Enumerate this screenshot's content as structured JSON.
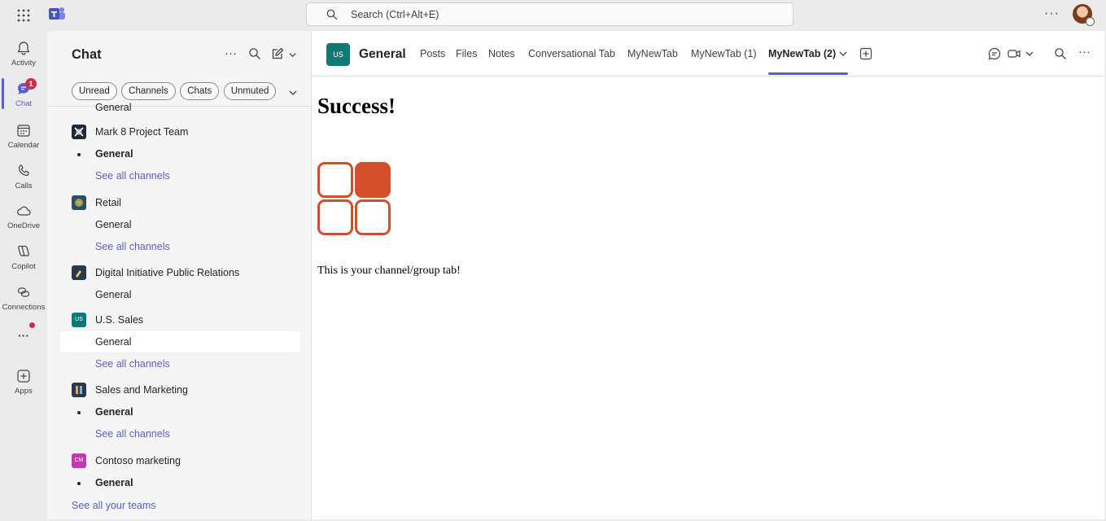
{
  "app": {
    "search_placeholder": "Search (Ctrl+Alt+E)",
    "more": "···"
  },
  "rail": {
    "items": [
      {
        "label": "Activity"
      },
      {
        "label": "Chat",
        "badge": "1"
      },
      {
        "label": "Calendar"
      },
      {
        "label": "Calls"
      },
      {
        "label": "OneDrive"
      },
      {
        "label": "Copilot"
      },
      {
        "label": "Connections"
      },
      {
        "label": "···"
      },
      {
        "label": "Apps"
      }
    ]
  },
  "chat_panel": {
    "title": "Chat",
    "more": "···",
    "filters": [
      "Unread",
      "Channels",
      "Chats",
      "Unmuted"
    ],
    "partial_channel": "General",
    "teams": [
      {
        "name": "Mark 8 Project Team",
        "icon_color": "#1f2937",
        "channels": [
          {
            "name": "General",
            "bold": true
          }
        ],
        "see_all": "See all channels"
      },
      {
        "name": "Retail",
        "icon_color": "#2f4f5e",
        "channels": [
          {
            "name": "General",
            "bold": false
          }
        ],
        "see_all": "See all channels"
      },
      {
        "name": "Digital Initiative Public Relations",
        "icon_color": "#2b3a4a",
        "channels": [
          {
            "name": "General",
            "bold": false
          }
        ]
      },
      {
        "name": "U.S. Sales",
        "icon_text": "US",
        "icon_color": "#0f7a75",
        "channels": [
          {
            "name": "General",
            "bold": false,
            "selected": true
          }
        ],
        "see_all": "See all channels"
      },
      {
        "name": "Sales and Marketing",
        "icon_color": "#2b3a4a",
        "channels": [
          {
            "name": "General",
            "bold": true
          }
        ],
        "see_all": "See all channels"
      },
      {
        "name": "Contoso marketing",
        "icon_text": "CM",
        "icon_color": "#c239b3",
        "channels": [
          {
            "name": "General",
            "bold": true
          }
        ]
      }
    ],
    "see_all_teams": "See all your teams"
  },
  "main": {
    "channel_avatar": "US",
    "channel_name": "General",
    "tabs": [
      "Posts",
      "Files",
      "Notes",
      "Conversational Tab",
      "MyNewTab",
      "MyNewTab (1)",
      "MyNewTab (2)"
    ],
    "active_tab": "MyNewTab (2)",
    "more": "···",
    "content": {
      "heading": "Success!",
      "text": "This is your channel/group tab!"
    }
  },
  "colors": {
    "accent": "#5b5fc7",
    "logo_orange": "#d5502a",
    "badge_red": "#c4314b"
  }
}
